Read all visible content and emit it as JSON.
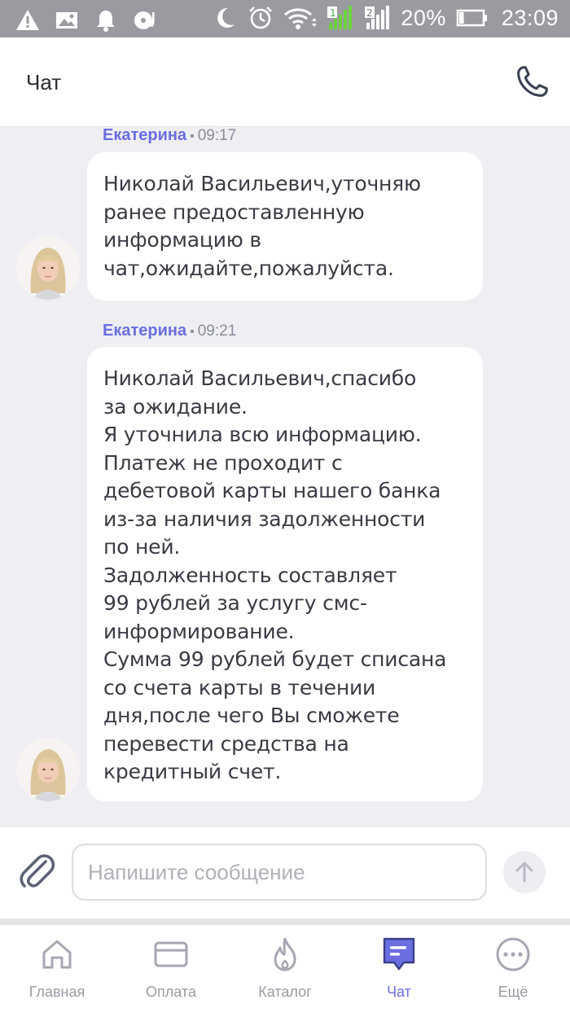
{
  "status_bar": {
    "icons_left": [
      "warning-icon",
      "image-icon",
      "bell-icon",
      "music-disc-icon"
    ],
    "icons_right": [
      "moon-icon",
      "alarm-icon",
      "wifi-icon",
      "signal-sim1-icon",
      "signal-sim2-icon",
      "battery-icon"
    ],
    "sim1_label": "1",
    "sim2_label": "2",
    "battery_percent": "20%",
    "battery_level": 0.2,
    "time": "23:09"
  },
  "header": {
    "title": "Чат",
    "call_icon": "phone-icon"
  },
  "messages": [
    {
      "author": "Екатерина",
      "separator": "•",
      "time": "09:17",
      "text": "Николай Васильевич,уточняю\nранее предоставленную\nинформацию в\nчат,ожидайте,пожалуйста."
    },
    {
      "author": "Екатерина",
      "separator": "•",
      "time": "09:21",
      "text": "Николай Васильевич,спасибо\nза ожидание.\nЯ уточнила всю информацию.\nПлатеж не проходит с\nдебетовой карты нашего банка\nиз-за наличия задолженности\nпо ней.\nЗадолженность составляет\n99 рублей за услугу смс-\nинформирование.\nСумма 99 рублей будет списана\nсо счета карты в течении\nдня,после чего Вы сможете\nперевести средства на\nкредитный счет."
    }
  ],
  "composer": {
    "placeholder": "Напишите сообщение",
    "value": "",
    "attach_icon": "paperclip-icon",
    "send_icon": "arrow-up-icon"
  },
  "nav": {
    "items": [
      {
        "label": "Главная",
        "icon": "home-icon",
        "active": false
      },
      {
        "label": "Оплата",
        "icon": "card-icon",
        "active": false
      },
      {
        "label": "Каталог",
        "icon": "flame-icon",
        "active": false
      },
      {
        "label": "Чат",
        "icon": "chat-icon",
        "active": true
      },
      {
        "label": "Ещё",
        "icon": "more-icon",
        "active": false
      }
    ]
  },
  "colors": {
    "accent": "#6a6ee0",
    "status_bar": "#9a9ba0",
    "chat_bg": "#eeeef3",
    "bubble": "#ffffff",
    "inactive": "#9a9ba5"
  }
}
